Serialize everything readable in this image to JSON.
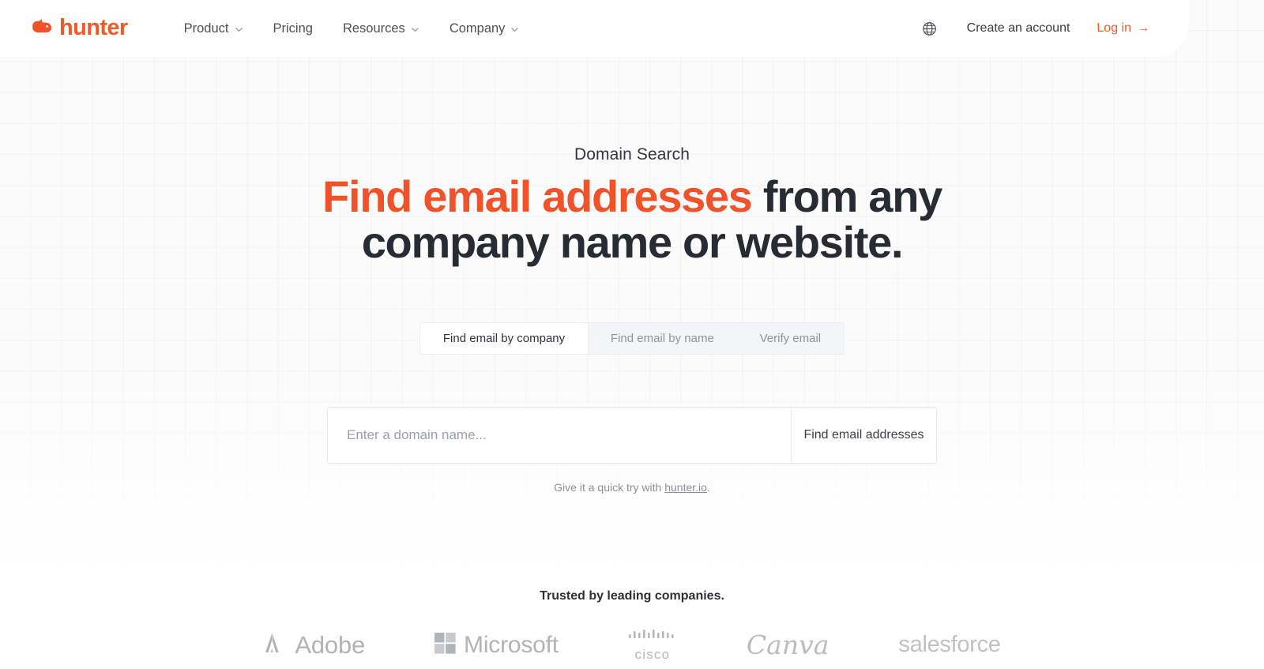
{
  "brand": {
    "logo_text": "hunter",
    "logo_icon": "hound-head-icon",
    "accent_color": "#f0522a"
  },
  "header": {
    "nav": [
      {
        "label": "Product",
        "has_chevron": true
      },
      {
        "label": "Pricing",
        "has_chevron": false
      },
      {
        "label": "Resources",
        "has_chevron": true
      },
      {
        "label": "Company",
        "has_chevron": true
      }
    ],
    "language_icon": "globe-icon",
    "create_account_label": "Create an account",
    "login_label": "Log in",
    "login_arrow": "→"
  },
  "hero": {
    "eyebrow": "Domain Search",
    "title_highlight": "Find email addresses",
    "title_rest": " from any company name or website."
  },
  "tabs": [
    {
      "label": "Find email by company",
      "active": true
    },
    {
      "label": "Find email by name",
      "active": false
    },
    {
      "label": "Verify email",
      "active": false
    }
  ],
  "search": {
    "placeholder": "Enter a domain name...",
    "value": "",
    "button_label": "Find email addresses",
    "hint_prefix": "Give it a quick try with ",
    "hint_link": "hunter.io",
    "hint_suffix": "."
  },
  "trusted": {
    "title": "Trusted by leading companies.",
    "logos": [
      {
        "name": "Adobe",
        "icon": "adobe-logo-icon"
      },
      {
        "name": "Microsoft",
        "icon": "microsoft-logo-icon"
      },
      {
        "name": "cisco",
        "icon": "cisco-logo-icon"
      },
      {
        "name": "Canva",
        "icon": "canva-logo-icon"
      },
      {
        "name": "salesforce",
        "icon": "salesforce-logo-icon"
      }
    ]
  }
}
